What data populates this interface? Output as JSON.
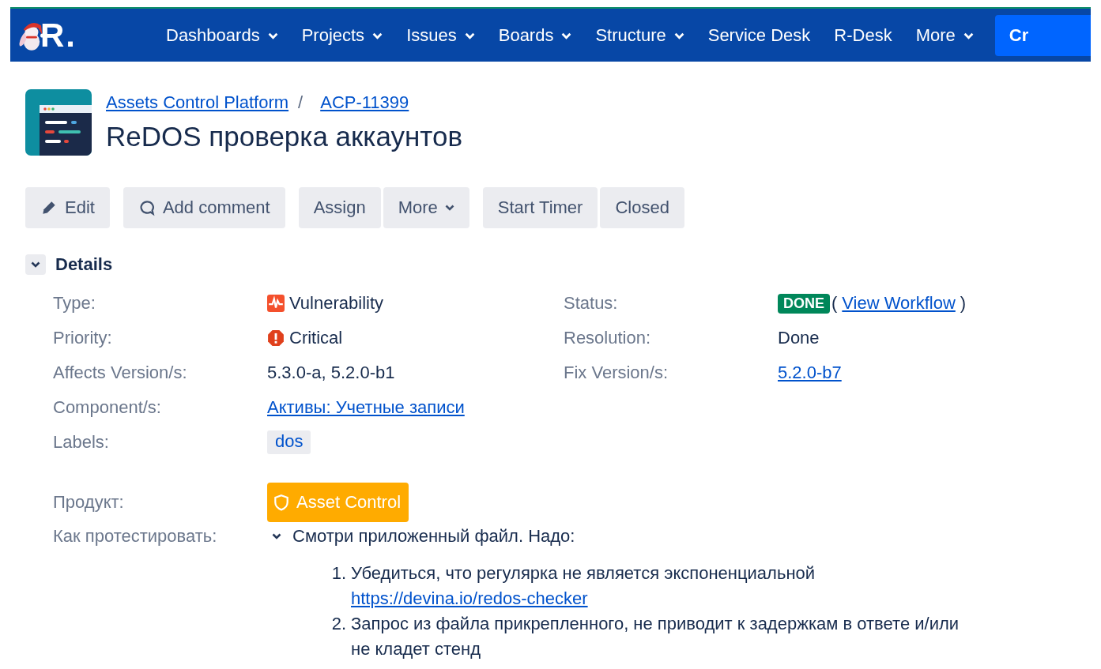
{
  "nav": {
    "logo_text": "R.",
    "items": [
      {
        "label": "Dashboards",
        "dropdown": true
      },
      {
        "label": "Projects",
        "dropdown": true
      },
      {
        "label": "Issues",
        "dropdown": true
      },
      {
        "label": "Boards",
        "dropdown": true
      },
      {
        "label": "Structure",
        "dropdown": true
      },
      {
        "label": "Service Desk",
        "dropdown": false
      },
      {
        "label": "R-Desk",
        "dropdown": false
      },
      {
        "label": "More",
        "dropdown": true
      }
    ],
    "create_button": "Cr"
  },
  "breadcrumbs": {
    "items": [
      "Assets Control Platform",
      "ACP-11399"
    ],
    "separator": "/"
  },
  "title": "ReDOS проверка аккаунтов",
  "toolbar": [
    [
      {
        "label": "Edit",
        "kind": "edit",
        "dropdown": false
      }
    ],
    [
      {
        "label": "Add comment",
        "kind": "comment",
        "dropdown": false
      }
    ],
    [
      {
        "label": "Assign",
        "kind": "plain",
        "dropdown": false
      },
      {
        "label": "More",
        "kind": "plain",
        "dropdown": true
      }
    ],
    [
      {
        "label": "Start Timer",
        "kind": "plain",
        "dropdown": false
      },
      {
        "label": "Closed",
        "kind": "plain",
        "dropdown": false
      }
    ]
  ],
  "details": {
    "heading": "Details",
    "expanded": true,
    "left": [
      {
        "label": "Type:",
        "kind": "issue_type",
        "value": "Vulnerability"
      },
      {
        "label": "Priority:",
        "kind": "priority",
        "value": "Critical"
      },
      {
        "label": "Affects Version/s:",
        "kind": "text",
        "value": "5.3.0-a, 5.2.0-b1"
      },
      {
        "label": "Component/s:",
        "kind": "link",
        "value": "Активы: Учетные записи"
      },
      {
        "label": "Labels:",
        "kind": "label",
        "value": "dos"
      }
    ],
    "right": [
      {
        "label": "Status:",
        "kind": "status",
        "value": "DONE",
        "open": "(",
        "link": "View Workflow",
        "close": ")"
      },
      {
        "label": "Resolution:",
        "kind": "text",
        "value": "Done"
      },
      {
        "label": "Fix Version/s:",
        "kind": "link",
        "value": "5.2.0-b7"
      }
    ]
  },
  "product": {
    "label": "Продукт:",
    "value": "Asset Control"
  },
  "how_to_test": {
    "label": "Как протестировать:",
    "expanded": true,
    "intro": "Смотри приложенный файл. Надо:",
    "items": [
      {
        "number": "1.",
        "text": "Убедиться, что регулярка не является экспоненциальной",
        "link": "https://devina.io/redos-checker"
      },
      {
        "number": "2.",
        "text": "Запрос из файла прикрепленного, не приводит к задержкам в ответе и/или не кладет стенд"
      }
    ]
  }
}
